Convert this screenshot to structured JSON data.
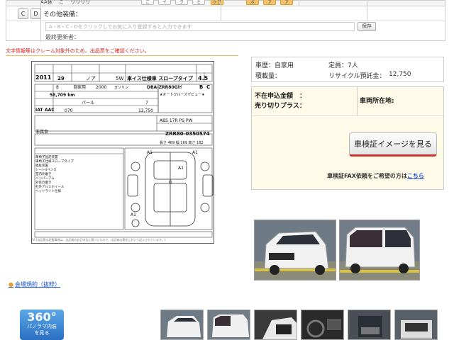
{
  "top_form": {
    "cut_label": "AA休 ゛こ ゛リリリリ",
    "check_buttons": [
      "ご",
      "イ",
      "ク",
      "ミ",
      "ケア",
      "ポ",
      "ア",
      "ア"
    ],
    "c_button": "C",
    "d_button": "D",
    "other_equipment_label": "その他装備：",
    "memo_placeholder": "A・B・C・Dをクリックしてお気に入り登録すると入力できます",
    "save_button": "保存",
    "last_updater_label": "最終更新者："
  },
  "notice": "文字情報等はクレーム対象外のため、出品票をご確認ください。",
  "sheet": {
    "year": "2011",
    "year_sub": "29",
    "model": "ノア",
    "seats": "5W",
    "title": "車イス仕様車 スロープタイプ",
    "grade": "4.5",
    "doors": "8",
    "usage": "自家用",
    "displacement": "2000",
    "fuel": "ガソリン",
    "model_code": "DBA-ZRR80Gｶｲ",
    "score_b": "B",
    "score_c": "C",
    "mileage": "58,709 km",
    "auto_cruise": "★オートクルーズデビュー★",
    "trans": "IAT",
    "ac": "AAC",
    "color": "パール",
    "color_no": "7",
    "color_code": "070",
    "recycle": "12,750",
    "equipment": "ABS 17R PS PW",
    "chassis": "ZRR80-0350574",
    "dims": "長さ 469  幅 169  高さ 182",
    "inspection_note": "非腐食",
    "features": "車椅子固定装置\n車椅子仕様スロープタイプ\n福祉装置\nシート4ペンス\n室内外磨き\nバンパーアム\n外装の磨き\n社外アルミホイール\nヘッドライト仕様",
    "footer": "AA (出品票の記載事項は、出品者の自己申告に基づくもので、出品者の責任において記入されています。)"
  },
  "info": {
    "history_label": "車歴：自家用",
    "capacity_label": "定員：7人",
    "load_label": "積載量：",
    "recycle_label": "リサイクル預託金：",
    "recycle_value": "12,750",
    "unsold_label": "不在申込金額　：",
    "sellplus_label": "売り切りプラス：",
    "location_label": "車両所在地:",
    "shaken_button": "車検証イメージを見る",
    "fax_text": "車検証FAX依頼をご希望の方は",
    "fax_link": "こちら"
  },
  "kiyaku_link": "会場規約（抜粋）",
  "pano": {
    "big": "360°",
    "line1": "パノラマ内装",
    "line2": "を見る"
  }
}
